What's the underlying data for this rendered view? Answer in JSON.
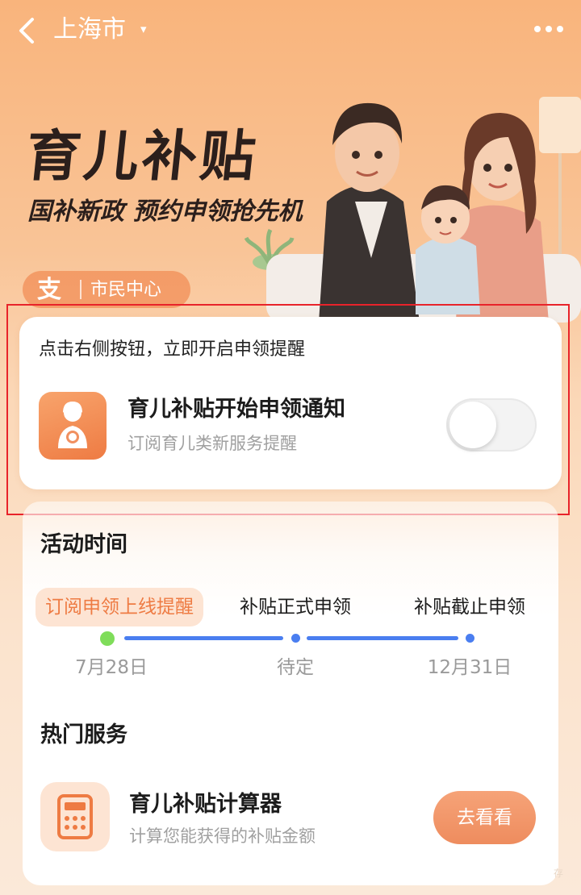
{
  "header": {
    "city": "上海市",
    "city_caret": "▾"
  },
  "hero": {
    "title": "育儿补贴",
    "subtitle": "国补新政  预约申领抢先机",
    "badge_logo": "支",
    "badge_text": "市民中心"
  },
  "reminder": {
    "hint": "点击右侧按钮，立即开启申领提醒",
    "title": "育儿补贴开始申领通知",
    "description": "订阅育儿类新服务提醒",
    "toggle_on": false
  },
  "activity": {
    "title": "活动时间",
    "stages": [
      {
        "label": "订阅申领上线提醒",
        "date": "7月28日",
        "active": true
      },
      {
        "label": "补贴正式申领",
        "date": "待定",
        "active": false
      },
      {
        "label": "补贴截止申领",
        "date": "12月31日",
        "active": false
      }
    ]
  },
  "services": {
    "title": "热门服务",
    "items": [
      {
        "title": "育儿补贴计算器",
        "description": "计算您能获得的补贴金额",
        "button": "去看看",
        "icon": "calculator-icon"
      }
    ]
  },
  "colors": {
    "accent": "#ee7b43",
    "timeline": "#4a7ef0",
    "timeline_start": "#7fdd5a",
    "highlight": "#e8232a"
  },
  "watermark": "存"
}
